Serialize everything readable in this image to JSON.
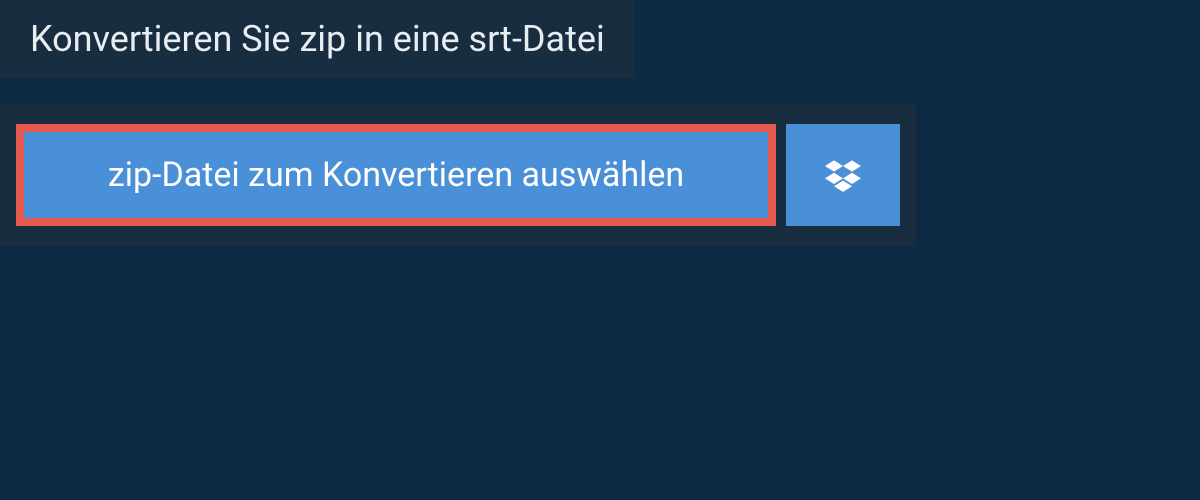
{
  "header": {
    "title": "Konvertieren Sie zip in eine srt-Datei"
  },
  "actions": {
    "select_file_label": "zip-Datei zum Konvertieren auswählen"
  },
  "colors": {
    "background": "#0e2a42",
    "panel": "#182d3f",
    "button": "#4a90d9",
    "highlight_border": "#e55a4f"
  }
}
